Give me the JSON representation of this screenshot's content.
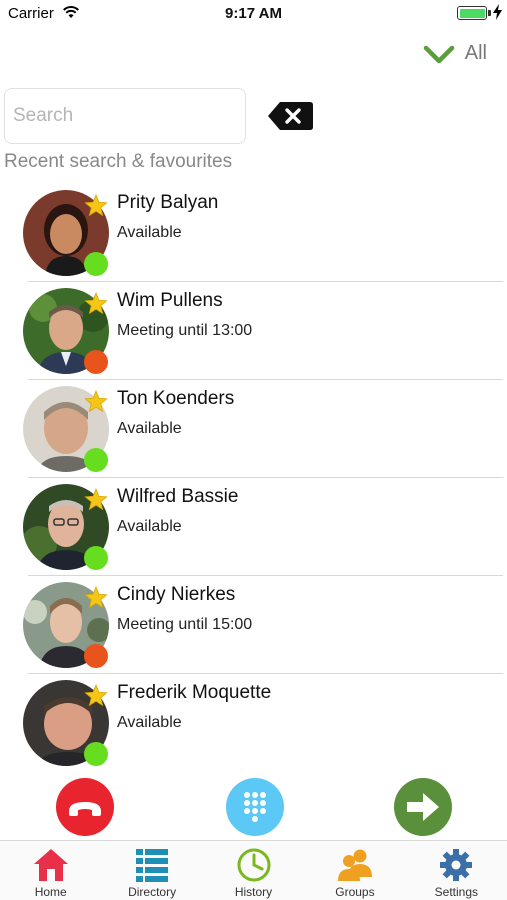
{
  "status_bar": {
    "carrier": "Carrier",
    "time": "9:17 AM",
    "battery_percent": 100
  },
  "filter": {
    "label": "All",
    "icon": "checkmark-icon",
    "color": "#5a9e3a"
  },
  "search": {
    "placeholder": "Search",
    "value": "",
    "clear_icon": "backspace-clear-icon"
  },
  "section_title": "Recent search & favourites",
  "colors": {
    "available": "#66dd1e",
    "busy": "#e8541c",
    "favourite_star": "#f5c518",
    "hangup": "#e8252e",
    "dialpad": "#5bc8f5",
    "forward": "#5a8f3c",
    "home_tab": "#e8304a",
    "directory_tab": "#1f8fb5",
    "history_tab": "#7ab81f",
    "groups_tab": "#f0a020",
    "settings_tab": "#3a6fa8"
  },
  "contacts": [
    {
      "name": "Prity Balyan",
      "status": "Available",
      "presence": "available",
      "favourite": true
    },
    {
      "name": "Wim Pullens",
      "status": "Meeting until 13:00",
      "presence": "busy",
      "favourite": true
    },
    {
      "name": "Ton Koenders",
      "status": "Available",
      "presence": "available",
      "favourite": true
    },
    {
      "name": "Wilfred Bassie",
      "status": "Available",
      "presence": "available",
      "favourite": true
    },
    {
      "name": "Cindy Nierkes",
      "status": "Meeting until 15:00",
      "presence": "busy",
      "favourite": true
    },
    {
      "name": "Frederik Moquette",
      "status": "Available",
      "presence": "available",
      "favourite": true
    }
  ],
  "actions": [
    {
      "icon": "hangup-phone-icon"
    },
    {
      "icon": "dialpad-icon"
    },
    {
      "icon": "forward-arrow-icon"
    }
  ],
  "tabs": [
    {
      "label": "Home",
      "icon": "home-icon"
    },
    {
      "label": "Directory",
      "icon": "directory-list-icon"
    },
    {
      "label": "History",
      "icon": "clock-icon"
    },
    {
      "label": "Groups",
      "icon": "groups-icon"
    },
    {
      "label": "Settings",
      "icon": "gear-icon"
    }
  ]
}
